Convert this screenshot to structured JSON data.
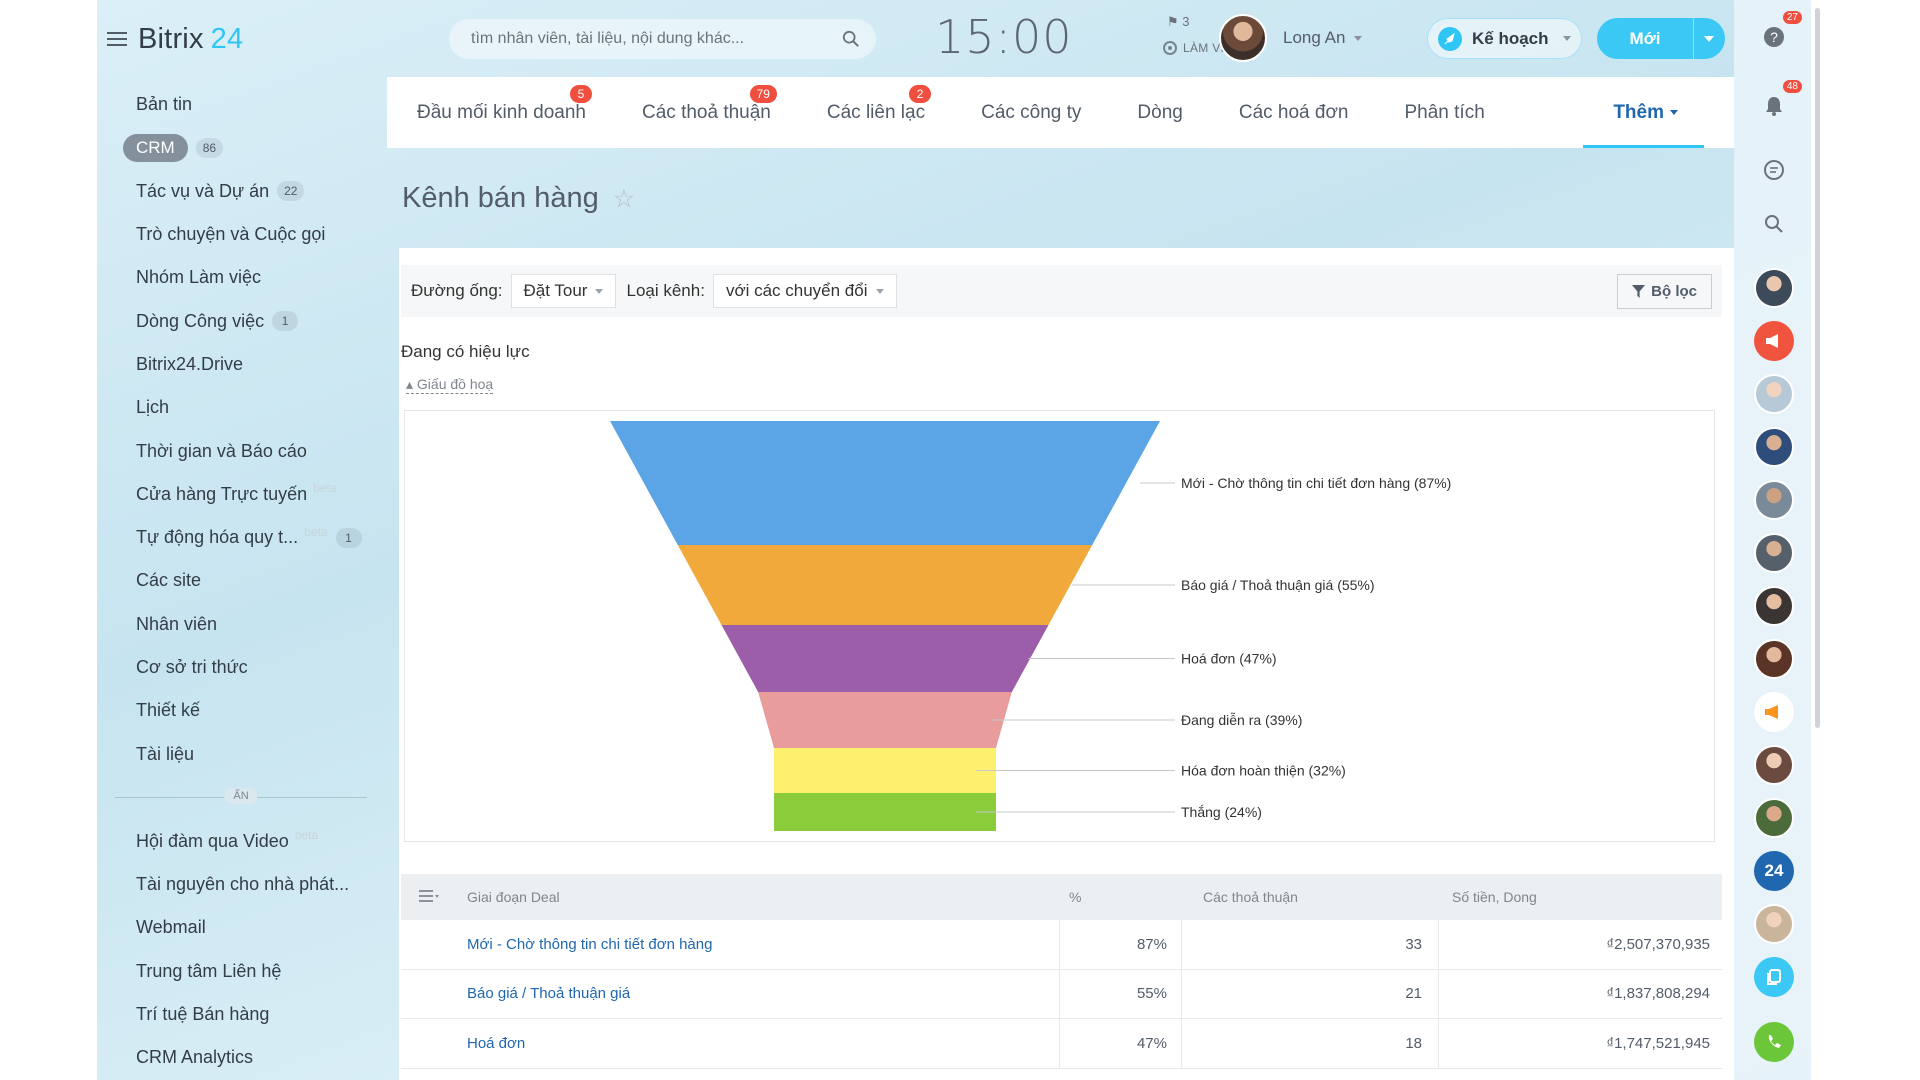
{
  "app": {
    "logo_text": "Bitrix",
    "logo_num": "24"
  },
  "sidebar": {
    "items": [
      {
        "label": "Bản tin",
        "count": "",
        "beta": ""
      },
      {
        "label": "CRM",
        "count": "86",
        "beta": "",
        "active": true
      },
      {
        "label": "Tác vụ và Dự án",
        "count": "22",
        "beta": ""
      },
      {
        "label": "Trò chuyện và Cuộc gọi",
        "count": "",
        "beta": ""
      },
      {
        "label": "Nhóm Làm việc",
        "count": "",
        "beta": ""
      },
      {
        "label": "Dòng Công việc",
        "count": "1",
        "beta": ""
      },
      {
        "label": "Bitrix24.Drive",
        "count": "",
        "beta": ""
      },
      {
        "label": "Lịch",
        "count": "",
        "beta": ""
      },
      {
        "label": "Thời gian và Báo cáo",
        "count": "",
        "beta": ""
      },
      {
        "label": "Cửa hàng Trực tuyến",
        "count": "",
        "beta": "beta"
      },
      {
        "label": "Tự động hóa quy t...",
        "count": "1",
        "beta": "beta"
      },
      {
        "label": "Các site",
        "count": "",
        "beta": ""
      },
      {
        "label": "Nhân viên",
        "count": "",
        "beta": ""
      },
      {
        "label": "Cơ sở tri thức",
        "count": "",
        "beta": ""
      },
      {
        "label": "Thiết kế",
        "count": "",
        "beta": ""
      },
      {
        "label": "Tài liệu",
        "count": "",
        "beta": ""
      }
    ],
    "hidden_label": "ẨN",
    "hidden_items": [
      {
        "label": "Hội đàm qua Video",
        "beta": "beta"
      },
      {
        "label": "Tài nguyên cho nhà phát...",
        "beta": ""
      },
      {
        "label": "Webmail",
        "beta": ""
      },
      {
        "label": "Trung tâm Liên hệ",
        "beta": ""
      },
      {
        "label": "Trí tuệ Bán hàng",
        "beta": ""
      },
      {
        "label": "CRM Analytics",
        "beta": ""
      }
    ]
  },
  "header": {
    "search_placeholder": "tìm nhân viên, tài liệu, nội dung khác...",
    "clock": "15:00",
    "flag_count": "3",
    "work_status": "LÀM VIỆC",
    "user_name": "Long An",
    "plan_label": "Kế hoạch",
    "new_label": "Mới"
  },
  "tabs": [
    {
      "label": "Đầu mối kinh doanh",
      "badge": "5"
    },
    {
      "label": "Các thoả thuận",
      "badge": "79"
    },
    {
      "label": "Các liên lạc",
      "badge": "2"
    },
    {
      "label": "Các công ty",
      "badge": ""
    },
    {
      "label": "Dòng",
      "badge": ""
    },
    {
      "label": "Các hoá đơn",
      "badge": ""
    },
    {
      "label": "Phân tích",
      "badge": ""
    },
    {
      "label": "Thêm",
      "badge": "",
      "active": true
    }
  ],
  "page": {
    "title": "Kênh bán hàng"
  },
  "filters": {
    "pipeline_label": "Đường ống:",
    "pipeline_value": "Đặt Tour",
    "channel_label": "Loại kênh:",
    "channel_value": "với các chuyển đổi",
    "filter_button": "Bộ lọc"
  },
  "section": {
    "label": "Đang có hiệu lực",
    "toggle_chart": "Giấu đồ hoạ"
  },
  "chart_data": {
    "type": "funnel",
    "stages": [
      {
        "label": "Mới - Chờ thông tin chi tiết đơn hàng (87%)",
        "value": 87,
        "color": "#5ba4e5"
      },
      {
        "label": "Báo giá / Thoả thuận giá (55%)",
        "value": 55,
        "color": "#f1a93b"
      },
      {
        "label": "Hoá đơn (47%)",
        "value": 47,
        "color": "#9c5ea8"
      },
      {
        "label": "Đang diễn ra (39%)",
        "value": 39,
        "color": "#e99c9c"
      },
      {
        "label": "Hóa đơn hoàn thiện (32%)",
        "value": 32,
        "color": "#fdf06c"
      },
      {
        "label": "Thắng (24%)",
        "value": 24,
        "color": "#8bcc3a"
      }
    ]
  },
  "table": {
    "headers": [
      "Giai đoạn Deal",
      "%",
      "Các thoả thuận",
      "Số tiền, Dong"
    ],
    "rows": [
      {
        "stage": "Mới - Chờ thông tin chi tiết đơn hàng",
        "pct": "87%",
        "deals": "33",
        "sum": "₫2,507,370,935"
      },
      {
        "stage": "Báo giá / Thoả thuận giá",
        "pct": "55%",
        "deals": "21",
        "sum": "₫1,837,808,294"
      },
      {
        "stage": "Hoá đơn",
        "pct": "47%",
        "deals": "18",
        "sum": "₫1,747,521,945"
      }
    ]
  },
  "rail": {
    "help_badge": "27",
    "notif_badge": "48",
    "b24_label": "24"
  }
}
